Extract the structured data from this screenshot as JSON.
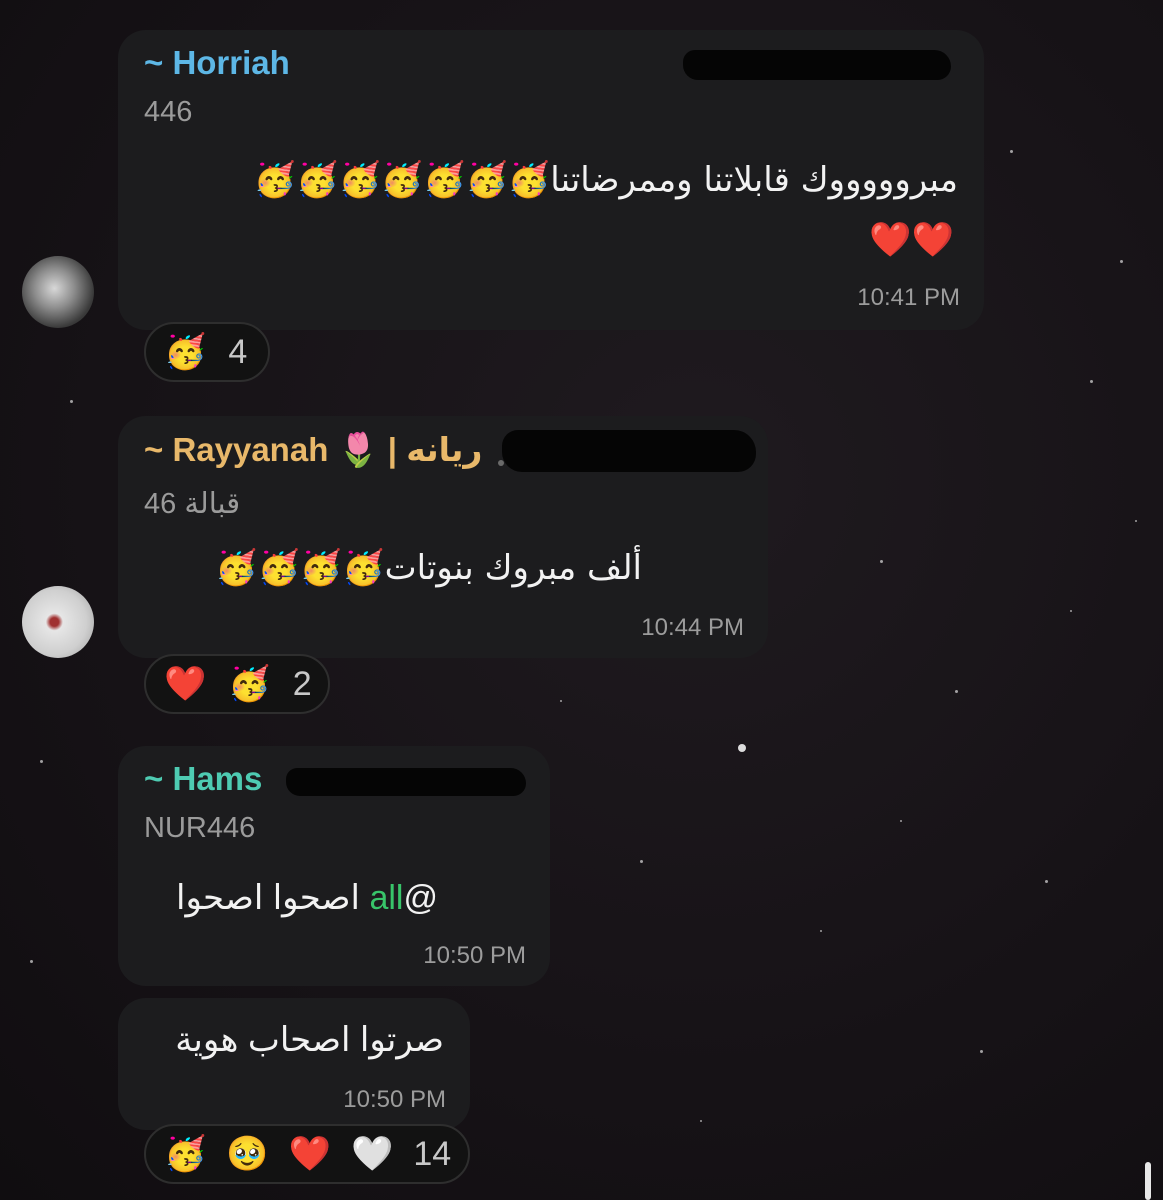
{
  "messages": [
    {
      "sender": "~ Horriah",
      "sender_color": "#5db7e6",
      "subtitle": "446",
      "text_line1": "مبروووووك قابلاتنا وممرضاتنا🥳🥳🥳🥳🥳🥳🥳",
      "text_line2": "❤️❤️",
      "time": "10:41 PM",
      "reactions": {
        "emojis": [
          "🥳"
        ],
        "count": "4"
      }
    },
    {
      "sender": "~ Rayyanah 🌷 | ريانه",
      "sender_color": "#e8b86a",
      "subtitle": "قبالة 46",
      "text_line1": "ألف مبروك بنوتات🥳🥳🥳🥳",
      "time": "10:44 PM",
      "reactions": {
        "emojis": [
          "❤️",
          "🥳"
        ],
        "count": "2"
      }
    },
    {
      "sender": "~ Hams",
      "sender_color": "#4ecbb2",
      "subtitle": "NUR446",
      "text_mention": "all",
      "text_prefix": "@",
      "text_rest": " اصحوا اصحوا",
      "time": "10:50 PM"
    },
    {
      "text_line1": "صرتوا اصحاب هوية",
      "time": "10:50 PM",
      "reactions": {
        "emojis": [
          "🥳",
          "🥹",
          "❤️",
          "🤍"
        ],
        "count": "14"
      }
    }
  ],
  "colors": {
    "bubble": "#1c1c1e",
    "mention": "#38c56a",
    "timestamp": "#9c9c9c"
  }
}
